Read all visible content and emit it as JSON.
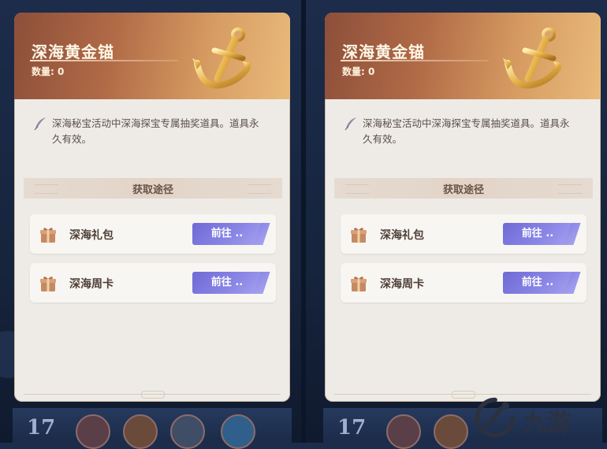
{
  "panels": [
    {
      "title": "深海黄金锚",
      "count_label": "数量: 0",
      "description": "深海秘宝活动中深海探宝专属抽奖道具。道具永久有效。",
      "section_title": "获取途径",
      "items": [
        {
          "label": "深海礼包",
          "button": "前往 .."
        },
        {
          "label": "深海周卡",
          "button": "前往 .."
        }
      ],
      "bottom_number": "17"
    },
    {
      "title": "深海黄金锚",
      "count_label": "数量: 0",
      "description": "深海秘宝活动中深海探宝专属抽奖道具。道具永久有效。",
      "section_title": "获取途径",
      "items": [
        {
          "label": "深海礼包",
          "button": "前往 .."
        },
        {
          "label": "深海周卡",
          "button": "前往 .."
        }
      ],
      "bottom_number": "17"
    }
  ],
  "watermark": {
    "text": "九游",
    "icon": "jiuyou-logo-icon"
  },
  "icons": {
    "item": "golden-anchor-icon",
    "description": "quill-icon",
    "source": "gift-box-icon"
  },
  "colors": {
    "banner_start": "#8d4f3a",
    "banner_end": "#e9bb7b",
    "button": "#7a76de",
    "card": "#eeebe7"
  }
}
